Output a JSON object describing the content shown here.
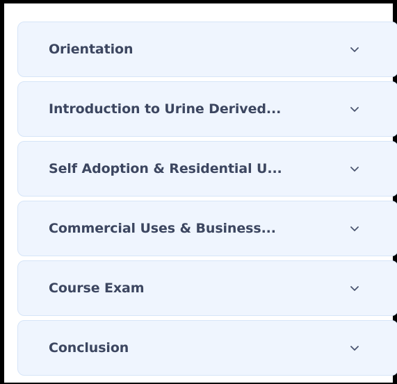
{
  "accordion": {
    "items": [
      {
        "label": "Orientation",
        "icon": "chevron-down-icon"
      },
      {
        "label": "Introduction to Urine Derived...",
        "icon": "chevron-down-icon"
      },
      {
        "label": "Self Adoption & Residential U...",
        "icon": "chevron-down-icon"
      },
      {
        "label": "Commercial Uses & Business...",
        "icon": "chevron-down-icon"
      },
      {
        "label": "Course Exam",
        "icon": "chevron-down-icon"
      },
      {
        "label": "Conclusion",
        "icon": "chevron-down-icon"
      }
    ]
  },
  "colors": {
    "item_background": "#eff5fe",
    "item_border": "#d6e5f8",
    "label_text": "#3c4660",
    "chevron": "#4a5570",
    "frame_border": "#000000"
  }
}
